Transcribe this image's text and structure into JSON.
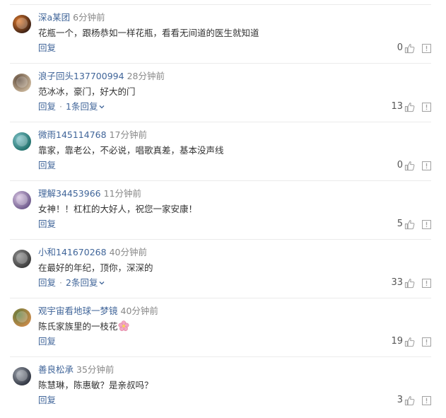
{
  "comments": [
    {
      "user": "深a某团",
      "time": "6分钟前",
      "text": "花瓶一个，跟杨恭如一样花瓶，看看无间道的医生就知道",
      "reply_label": "回复",
      "more_replies": "",
      "likes": "0",
      "avatar_colors": [
        "#3a1f14",
        "#e07a2c"
      ]
    },
    {
      "user": "浪子回头137700994",
      "time": "28分钟前",
      "text": "范冰冰，豪门，好大的门",
      "reply_label": "回复",
      "more_replies": "1条回复",
      "likes": "13",
      "avatar_colors": [
        "#c9b59a",
        "#5a4636"
      ]
    },
    {
      "user": "微雨145114768",
      "time": "17分钟前",
      "text": "靠家，靠老公，不必说，唱歌真差，基本没声线",
      "reply_label": "回复",
      "more_replies": "",
      "likes": "0",
      "avatar_colors": [
        "#1f6f6a",
        "#7fc3c9"
      ]
    },
    {
      "user": "理解34453966",
      "time": "11分钟前",
      "text": "女神！！杠杠的大好人，祝您一家安康！",
      "reply_label": "回复",
      "more_replies": "",
      "likes": "5",
      "avatar_colors": [
        "#6e5a8c",
        "#d6c2e0"
      ]
    },
    {
      "user": "小和141670268",
      "time": "40分钟前",
      "text": "在最好的年纪，顶你，深深的",
      "reply_label": "回复",
      "more_replies": "2条回复",
      "likes": "33",
      "avatar_colors": [
        "#3b3b3b",
        "#8c8c8c"
      ]
    },
    {
      "user": "观宇宙看地球一梦镜",
      "time": "40分钟前",
      "text": "陈氏家族里的一枝花",
      "reply_label": "回复",
      "more_replies": "",
      "likes": "19",
      "has_flower": true,
      "avatar_colors": [
        "#c98a4a",
        "#5a7a3a"
      ]
    },
    {
      "user": "善良松承",
      "time": "35分钟前",
      "text": "陈慧琳，陈惠敏？是亲叔吗？",
      "reply_label": "回复",
      "more_replies": "",
      "likes": "3",
      "avatar_colors": [
        "#2f3440",
        "#9aa0aa"
      ]
    }
  ],
  "separator": "·",
  "colors": {
    "username": "#406599",
    "time": "#888888",
    "text": "#333333",
    "icon": "#a0a0a0",
    "divider": "#ebebeb"
  },
  "icons": {
    "like": "thumbs-up-icon",
    "report": "report-icon",
    "expand": "chevron-down-icon",
    "emoji": "flower-emoji-icon"
  }
}
